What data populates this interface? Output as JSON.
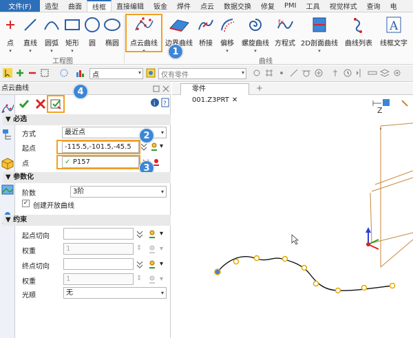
{
  "menubar": {
    "file": "文件(F)",
    "items": [
      "造型",
      "曲面",
      "线框",
      "直接编辑",
      "钣金",
      "焊件",
      "点云",
      "数据交换",
      "修复",
      "PMI",
      "工具",
      "视觉样式",
      "查询",
      "电"
    ],
    "active": "线框"
  },
  "ribbon": {
    "buttons": {
      "point": "点",
      "line": "直线",
      "arc": "圆弧",
      "rect": "矩形",
      "circle": "圆",
      "ellipse": "椭圆",
      "pointcloud_curve": "点云曲线",
      "boundary_curve": "边界曲线",
      "bridge": "桥接",
      "offset": "偏移",
      "helix": "螺旋曲线",
      "equation": "方程式",
      "section2d": "2D剖面曲线",
      "curve_list": "曲线列表",
      "line_text": "线框文字"
    },
    "groups": {
      "sketch": "工程图",
      "curve": "曲线"
    }
  },
  "toolbar2": {
    "filter_value": "点",
    "scope_value": "仅有零件"
  },
  "panel": {
    "title": "点云曲线",
    "required": {
      "header": "必选",
      "method_label": "方式",
      "method_value": "最近点",
      "start_label": "起点",
      "start_value": "-115.5,-101.5,-45.5",
      "point_label": "点",
      "point_value": "P157"
    },
    "param": {
      "header": "参数化",
      "degree_label": "阶数",
      "degree_value": "3阶",
      "open_curve_label": "创建开放曲线"
    },
    "constraint": {
      "header": "约束",
      "start_tangent_label": "起点切向",
      "weight1_label": "权重",
      "weight1_value": "1",
      "end_tangent_label": "终点切向",
      "weight2_label": "权重",
      "weight2_value": "1",
      "smooth_label": "光顺",
      "smooth_value": "无"
    }
  },
  "viewport": {
    "tab": "零件001.Z3PRT",
    "axis_z": "Z"
  },
  "badges": [
    "1",
    "2",
    "3",
    "4"
  ],
  "colors": {
    "accent": "#2d6fb8",
    "highlight": "#f0a020",
    "badge": "#3c86d8",
    "curve_point": "#f0b000",
    "wire": "#c8863a"
  }
}
